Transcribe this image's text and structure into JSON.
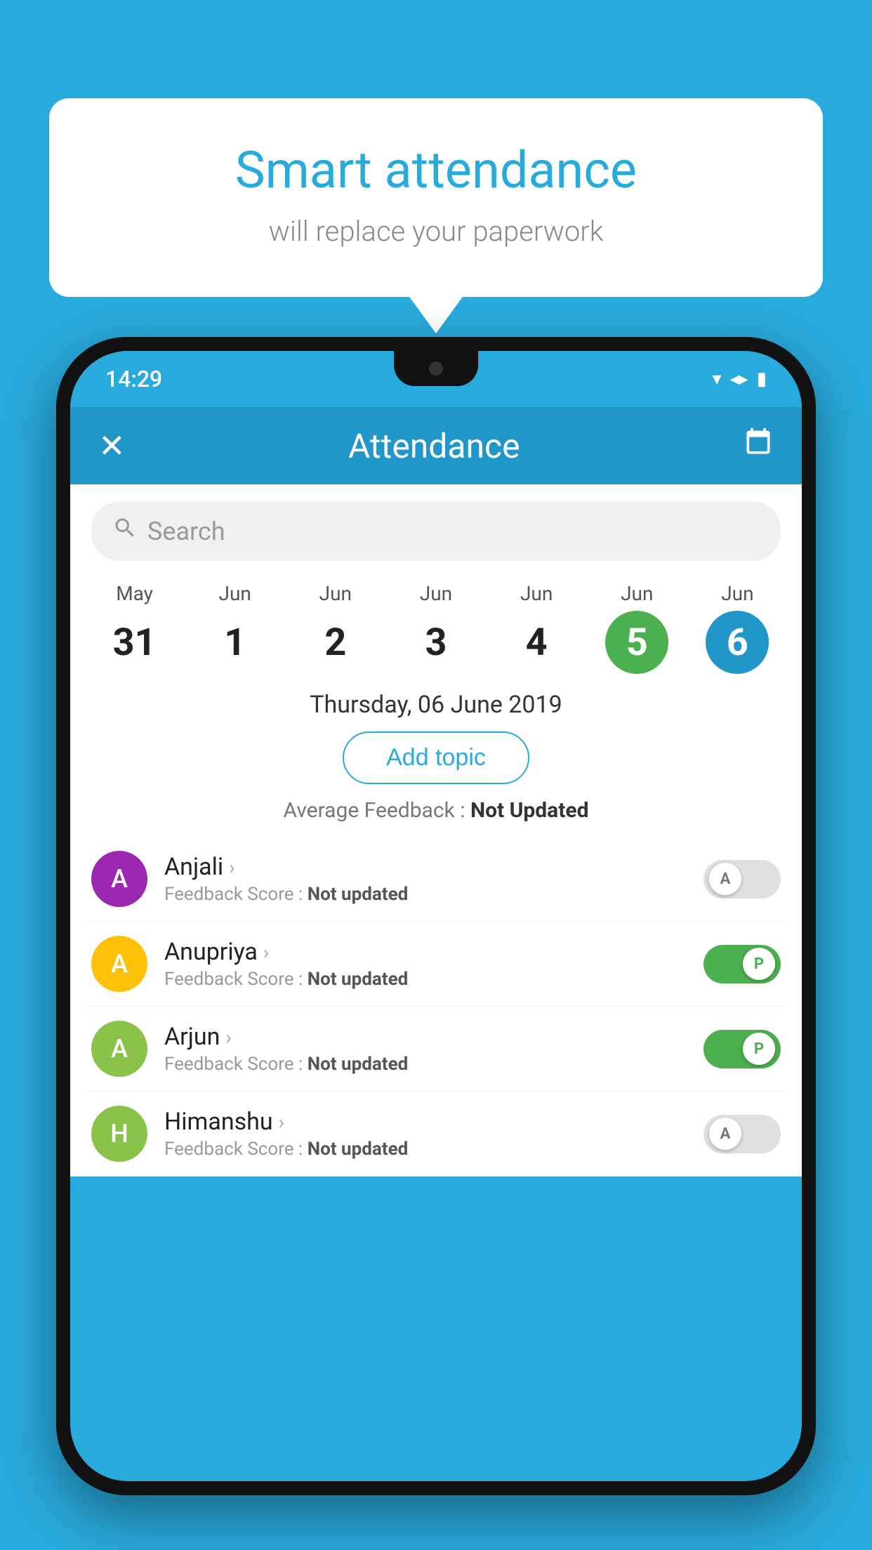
{
  "background_color": "#29AADC",
  "speech_bubble": {
    "title": "Smart attendance",
    "subtitle": "will replace your paperwork"
  },
  "status_bar": {
    "time": "14:29",
    "icons": [
      "▾◂",
      "◂▸",
      "▮▮▮"
    ]
  },
  "header": {
    "close_label": "✕",
    "title": "Attendance",
    "calendar_icon": "📅"
  },
  "search": {
    "placeholder": "Search"
  },
  "calendar": {
    "days": [
      {
        "month": "May",
        "date": "31",
        "style": "normal"
      },
      {
        "month": "Jun",
        "date": "1",
        "style": "normal"
      },
      {
        "month": "Jun",
        "date": "2",
        "style": "normal"
      },
      {
        "month": "Jun",
        "date": "3",
        "style": "normal"
      },
      {
        "month": "Jun",
        "date": "4",
        "style": "normal"
      },
      {
        "month": "Jun",
        "date": "5",
        "style": "today"
      },
      {
        "month": "Jun",
        "date": "6",
        "style": "selected"
      }
    ]
  },
  "selected_date_label": "Thursday, 06 June 2019",
  "add_topic_label": "Add topic",
  "average_feedback": {
    "label": "Average Feedback :",
    "value": "Not Updated"
  },
  "students": [
    {
      "name": "Anjali",
      "avatar_letter": "A",
      "avatar_color": "#9C27B0",
      "feedback_label": "Feedback Score :",
      "feedback_value": "Not updated",
      "attendance": "off",
      "toggle_letter": "A"
    },
    {
      "name": "Anupriya",
      "avatar_letter": "A",
      "avatar_color": "#FFC107",
      "feedback_label": "Feedback Score :",
      "feedback_value": "Not updated",
      "attendance": "on",
      "toggle_letter": "P"
    },
    {
      "name": "Arjun",
      "avatar_letter": "A",
      "avatar_color": "#8BC34A",
      "feedback_label": "Feedback Score :",
      "feedback_value": "Not updated",
      "attendance": "on",
      "toggle_letter": "P"
    },
    {
      "name": "Himanshu",
      "avatar_letter": "H",
      "avatar_color": "#8BC34A",
      "feedback_label": "Feedback Score :",
      "feedback_value": "Not updated",
      "attendance": "off",
      "toggle_letter": "A"
    }
  ]
}
